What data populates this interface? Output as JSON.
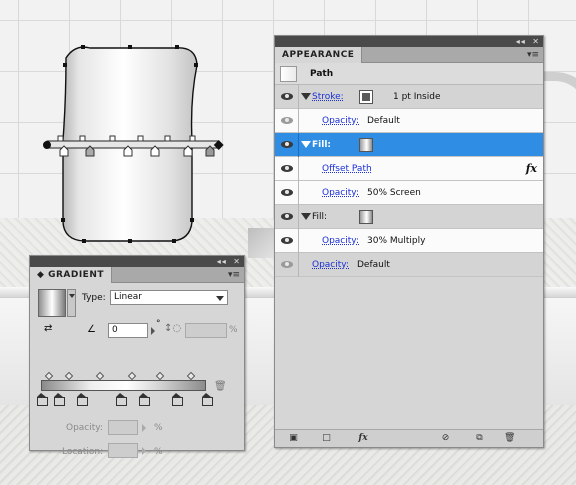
{
  "appearance": {
    "tab_label": "APPEARANCE",
    "menu_icon": "panel-menu-icon",
    "header": {
      "object": "Path"
    },
    "rows": [
      {
        "kind": "stroke",
        "label": "Stroke:",
        "value": "1 pt  Inside"
      },
      {
        "kind": "opacity",
        "label": "Opacity:",
        "value": "Default"
      },
      {
        "kind": "fill",
        "label": "Fill:",
        "selected": true
      },
      {
        "kind": "effect",
        "label": "Offset Path",
        "icon": "fx-icon"
      },
      {
        "kind": "opacity",
        "label": "Opacity:",
        "value": "50% Screen"
      },
      {
        "kind": "fill",
        "label": "Fill:"
      },
      {
        "kind": "opacity",
        "label": "Opacity:",
        "value": "30% Multiply"
      },
      {
        "kind": "opacity-object",
        "label": "Opacity:",
        "value": "Default"
      }
    ],
    "footer_icons": [
      "add-stroke-icon",
      "add-fill-icon",
      "add-effect-icon",
      "clear-appearance-icon",
      "duplicate-item-icon",
      "delete-item-icon"
    ],
    "footer_glyphs": {
      "add_effect": "fx",
      "delete": "🗑"
    }
  },
  "gradient": {
    "tab_label": "GRADIENT",
    "type_label": "Type:",
    "type_value": "Linear",
    "angle_value": "0",
    "angle_unit": "°",
    "aspect_value": "",
    "aspect_unit": "%",
    "opacity_label": "Opacity:",
    "opacity_value": "",
    "opacity_unit": "%",
    "location_label": "Location:",
    "location_value": "",
    "location_unit": "%",
    "stops": [
      0.0,
      0.1,
      0.24,
      0.48,
      0.62,
      0.82,
      1.0
    ],
    "midpoints": [
      0.05,
      0.17,
      0.36,
      0.55,
      0.72,
      0.91
    ]
  },
  "colors": {
    "selection_blue": "#2f8de4",
    "link_blue": "#1a2fd6",
    "titlebar": "#4a4a4a",
    "panel_bg": "#d6d6d6"
  }
}
